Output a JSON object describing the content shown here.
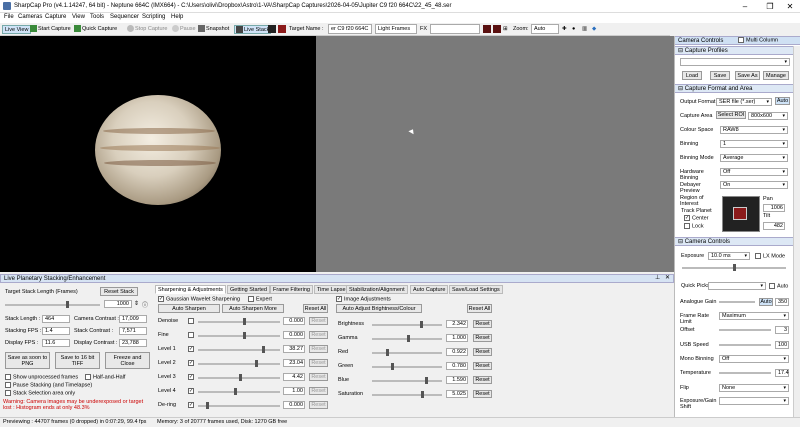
{
  "window": {
    "title": "SharpCap Pro (v4.1.14247, 64 bit) - Neptune 664C (IMX664) - C:\\Users\\olivi\\Dropbox\\Astro\\1-VA\\SharpCap Captures\\2026-04-05\\Jupiter C9 f20 664C\\22_45_48.ser"
  },
  "menu": [
    "File",
    "Cameras",
    "Capture",
    "View",
    "Tools",
    "Sequencer",
    "Scripting",
    "Help"
  ],
  "toolbar": {
    "live_view": "Live View",
    "start_capture": "Start Capture",
    "quick_capture": "Quick Capture",
    "stop_capture": "Stop Capture",
    "pause": "Pause",
    "snapshot": "Snapshot",
    "live_stack": "Live Stack",
    "target_name_label": "Target Name :",
    "target_name_value": "er C9 f20 664C",
    "frame_type": "Light Frames",
    "fx_label": "FX",
    "zoom_label": "Zoom:",
    "zoom_value": "Auto"
  },
  "stacking": {
    "title": "Live Planetary Stacking/Enhancement",
    "target_stack_length_label": "Target Stack Length (Frames)",
    "reset_stack": "Reset Stack",
    "target_value": "1000",
    "stack_length_label": "Stack Length :",
    "stack_length": "464",
    "camera_contrast_label": "Camera Contrast :",
    "camera_contrast": "17,009",
    "stacking_fps_label": "Stacking FPS :",
    "stacking_fps": "1.4",
    "stack_contrast_label": "Stack Contrast :",
    "stack_contrast": "7,571",
    "display_fps_label": "Display FPS :",
    "display_fps": "11.6",
    "display_contrast_label": "Display Contrast :",
    "display_contrast": "23,788",
    "save_png": "Save as soon to PNG",
    "save_tiff": "Save to 16 bit TIFF",
    "freeze": "Freeze and Close",
    "show_unprocessed": "Show unprocessed frames",
    "half_and_half": "Half-and-Half",
    "pause_stacking": "Pause Stacking (and Timelapse)",
    "stack_selection": "Stack Selection area only",
    "warning": "Warning: Camera images may be underexposed or target lost : Histogram ends at only 48.3%"
  },
  "tabs": [
    "Sharpening & Adjustments",
    "Getting Started",
    "Frame Filtering",
    "Time Lapse",
    "Stabilization/Alignment",
    "Auto Capture",
    "Save/Load Settings"
  ],
  "sharpening": {
    "gaussian": "Gaussian Wavelet Sharpening",
    "expert": "Expert",
    "auto_sharpen": "Auto Sharpen",
    "auto_sharpen_more": "Auto Sharpen More",
    "reset_all": "Reset All",
    "rows": [
      {
        "label": "Denoise",
        "value": "0.000",
        "pos": 0.55,
        "checked": false
      },
      {
        "label": "Fine",
        "value": "0.000",
        "pos": 0.55,
        "checked": false
      },
      {
        "label": "Level 1",
        "value": "38.27",
        "pos": 0.78,
        "checked": true
      },
      {
        "label": "Level 2",
        "value": "23.04",
        "pos": 0.7,
        "checked": true
      },
      {
        "label": "Level 3",
        "value": "4.42",
        "pos": 0.5,
        "checked": true
      },
      {
        "label": "Level 4",
        "value": "1.00",
        "pos": 0.44,
        "checked": true
      },
      {
        "label": "De-ring",
        "value": "0.000",
        "pos": 0.1,
        "checked": true
      }
    ],
    "reset": "Reset"
  },
  "image_adj": {
    "title": "Image Adjustments",
    "auto_adjust": "Auto Adjust Brightness/Colour",
    "reset_all": "Reset All",
    "reset": "Reset",
    "rows": [
      {
        "label": "Brightness",
        "value": "2.342",
        "pos": 0.68
      },
      {
        "label": "Gamma",
        "value": "1.000",
        "pos": 0.5
      },
      {
        "label": "Red",
        "value": "0.922",
        "pos": 0.2
      },
      {
        "label": "Green",
        "value": "0.780",
        "pos": 0.27
      },
      {
        "label": "Blue",
        "value": "1.590",
        "pos": 0.75
      },
      {
        "label": "Saturation",
        "value": "5.025",
        "pos": 0.7
      }
    ]
  },
  "status": {
    "left": "Previewing : 44707 frames (0 dropped) in 0:07:29, 99.4 fps",
    "right": "Memory: 3 of 20777 frames used, Disk: 1270 GB free"
  },
  "camera_controls": {
    "title": "Camera Controls",
    "multi": "Multi Column",
    "capture_profiles": "Capture Profiles",
    "load": "Load",
    "save": "Save",
    "save_as": "Save As",
    "manage": "Manage",
    "format_area": "Capture Format and Area",
    "rows": [
      {
        "label": "Output Format",
        "value": "SER file (*.ser)"
      },
      {
        "label": "Capture Area",
        "value": "800x600"
      },
      {
        "label": "Colour Space",
        "value": "RAW8"
      },
      {
        "label": "Binning",
        "value": "1"
      },
      {
        "label": "Binning Mode",
        "value": "Average"
      },
      {
        "label": "Hardware Binning",
        "value": "Off"
      },
      {
        "label": "Debayer Preview",
        "value": "On"
      }
    ],
    "auto": "Auto",
    "select_roi": "Select ROI",
    "roi_label": "Region of Interest",
    "pan": "Pan",
    "pan_value": "1006",
    "track_planet": "Track Planet",
    "center": "Center",
    "lock": "Lock",
    "tilt": "Tilt",
    "tilt_value": "482",
    "camera_controls": "Camera Controls",
    "exposure_label": "Exposure",
    "exposure_value": "10.0 ms",
    "lx_mode": "LX Mode",
    "quick_picks": "Quick Picks",
    "rows2": [
      {
        "label": "Analogue Gain",
        "value": "350"
      },
      {
        "label": "Frame Rate Limit",
        "value": "Maximum"
      },
      {
        "label": "Offset",
        "value": "3"
      },
      {
        "label": "USB Speed",
        "value": "100"
      },
      {
        "label": "Mono Binning",
        "value": "Off"
      },
      {
        "label": "Temperature",
        "value": "17.4"
      },
      {
        "label": "Flip",
        "value": "None"
      },
      {
        "label": "Exposure/Gain Shift",
        "value": ""
      }
    ]
  }
}
